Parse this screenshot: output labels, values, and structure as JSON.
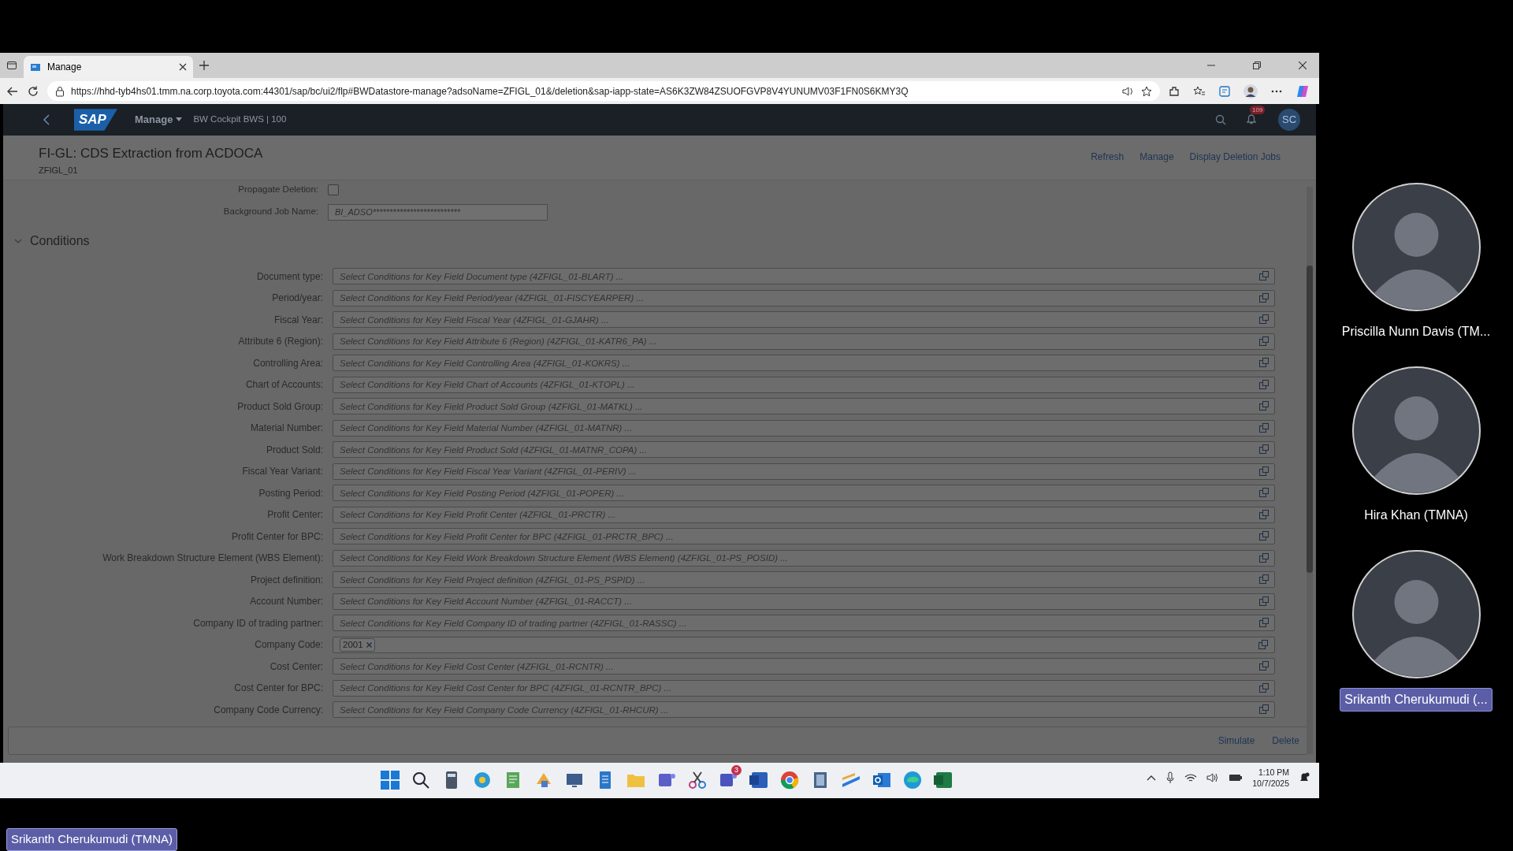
{
  "browser": {
    "tabs": [
      {
        "title": "Manage",
        "selected": true
      }
    ],
    "url": "https://hhd-tyb4hs01.tmm.na.corp.toyota.com:44301/sap/bc/ui2/flp#BWDatastore-manage?adsoName=ZFIGL_01&/deletion&sap-iapp-state=AS6K3ZW84ZSUOFGVP8V4YUNUMV03F1FN0S6KMY3Q"
  },
  "shell": {
    "logo": "SAP",
    "app": "Manage",
    "context": "BW Cockpit BWS | 100",
    "notification_count": "109",
    "avatar": "SC"
  },
  "header": {
    "title": "FI-GL: CDS Extraction from ACDOCA",
    "subtitle": "ZFIGL_01",
    "actions": [
      "Refresh",
      "Manage",
      "Display Deletion Jobs"
    ]
  },
  "options": [
    {
      "label": "Propagate Deletion:",
      "kind": "checkbox",
      "checked": false
    },
    {
      "label": "Background Job Name:",
      "kind": "text",
      "value": "BI_ADSO**************************"
    }
  ],
  "section": {
    "title": "Conditions",
    "expanded": true
  },
  "conditions": [
    {
      "label": "Document type:",
      "placeholder": "Select Conditions for Key Field Document type (4ZFIGL_01-BLART) ..."
    },
    {
      "label": "Period/year:",
      "placeholder": "Select Conditions for Key Field Period/year (4ZFIGL_01-FISCYEARPER) ..."
    },
    {
      "label": "Fiscal Year:",
      "placeholder": "Select Conditions for Key Field Fiscal Year (4ZFIGL_01-GJAHR) ..."
    },
    {
      "label": "Attribute 6 (Region):",
      "placeholder": "Select Conditions for Key Field Attribute 6 (Region) (4ZFIGL_01-KATR6_PA) ..."
    },
    {
      "label": "Controlling Area:",
      "placeholder": "Select Conditions for Key Field Controlling Area (4ZFIGL_01-KOKRS) ..."
    },
    {
      "label": "Chart of Accounts:",
      "placeholder": "Select Conditions for Key Field Chart of Accounts (4ZFIGL_01-KTOPL) ..."
    },
    {
      "label": "Product Sold Group:",
      "placeholder": "Select Conditions for Key Field Product Sold Group (4ZFIGL_01-MATKL) ..."
    },
    {
      "label": "Material Number:",
      "placeholder": "Select Conditions for Key Field Material Number (4ZFIGL_01-MATNR) ..."
    },
    {
      "label": "Product Sold:",
      "placeholder": "Select Conditions for Key Field Product Sold (4ZFIGL_01-MATNR_COPA) ..."
    },
    {
      "label": "Fiscal Year Variant:",
      "placeholder": "Select Conditions for Key Field Fiscal Year Variant (4ZFIGL_01-PERIV) ..."
    },
    {
      "label": "Posting Period:",
      "placeholder": "Select Conditions for Key Field Posting Period (4ZFIGL_01-POPER) ..."
    },
    {
      "label": "Profit Center:",
      "placeholder": "Select Conditions for Key Field Profit Center (4ZFIGL_01-PRCTR) ..."
    },
    {
      "label": "Profit Center for BPC:",
      "placeholder": "Select Conditions for Key Field Profit Center for BPC (4ZFIGL_01-PRCTR_BPC) ..."
    },
    {
      "label": "Work Breakdown Structure Element (WBS Element):",
      "placeholder": "Select Conditions for Key Field Work Breakdown Structure Element (WBS Element) (4ZFIGL_01-PS_POSID) ..."
    },
    {
      "label": "Project definition:",
      "placeholder": "Select Conditions for Key Field Project definition (4ZFIGL_01-PS_PSPID) ..."
    },
    {
      "label": "Account Number:",
      "placeholder": "Select Conditions for Key Field Account Number (4ZFIGL_01-RACCT) ..."
    },
    {
      "label": "Company ID of trading partner:",
      "placeholder": "Select Conditions for Key Field Company ID of trading partner (4ZFIGL_01-RASSC) ..."
    },
    {
      "label": "Company Code:",
      "tokens": [
        "2001"
      ]
    },
    {
      "label": "Cost Center:",
      "placeholder": "Select Conditions for Key Field Cost Center (4ZFIGL_01-RCNTR) ..."
    },
    {
      "label": "Cost Center for BPC:",
      "placeholder": "Select Conditions for Key Field Cost Center for BPC (4ZFIGL_01-RCNTR_BPC) ..."
    },
    {
      "label": "Company Code Currency:",
      "placeholder": "Select Conditions for Key Field Company Code Currency (4ZFIGL_01-RHCUR) ..."
    }
  ],
  "footer": {
    "buttons": [
      "Simulate",
      "Delete"
    ]
  },
  "taskbar": {
    "badge": "3",
    "time": "1:10 PM",
    "date": "10/7/2025"
  },
  "participants": [
    {
      "name": "Priscilla Nunn Davis (TM...",
      "speaking": false
    },
    {
      "name": "Hira Khan (TMNA)",
      "speaking": false
    },
    {
      "name": "Srikanth Cherukumudi (...",
      "speaking": true
    }
  ],
  "presenter": "Srikanth Cherukumudi (TMNA)"
}
